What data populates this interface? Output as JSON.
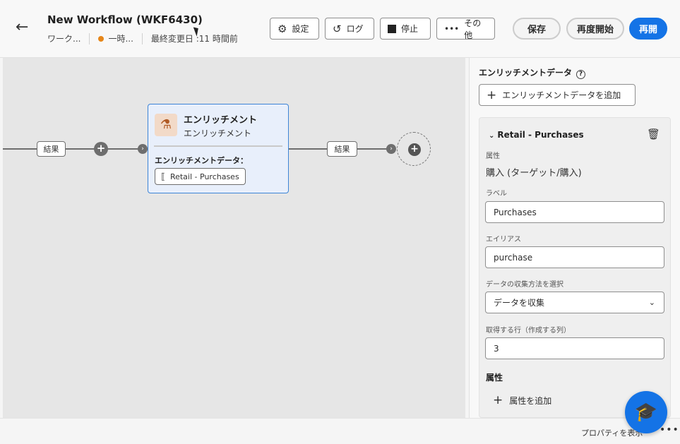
{
  "header": {
    "back_icon": "arrow-left-icon",
    "title": "New Workflow (WKF6430)",
    "meta_type": "ワーク...",
    "meta_status": "一時...",
    "meta_modified": "最終変更日 :11 時間前",
    "settings_label": "設定",
    "log_label": "ログ",
    "stop_label": "停止",
    "more_label": "その他",
    "save_label": "保存",
    "restart_label": "再度開始",
    "resume_label": "再開",
    "status_color": "#e68619",
    "accent_color": "#1473e6"
  },
  "canvas": {
    "result_chip_1": "結果",
    "result_chip_2": "結果",
    "node": {
      "title": "エンリッチメント",
      "subtitle": "エンリッチメント",
      "section_label": "エンリッチメントデータ：",
      "tag_label": "Retail - Purchases"
    }
  },
  "panel": {
    "heading": "エンリッチメントデータ",
    "add_button": "エンリッチメントデータを追加",
    "card": {
      "title": "Retail - Purchases",
      "attribute_label": "属性",
      "attribute_value": "購入 (ターゲット/購入)",
      "label_label": "ラベル",
      "label_value": "Purchases",
      "alias_label": "エイリアス",
      "alias_value": "purchase",
      "collect_label": "データの収集方法を選択",
      "collect_value": "データを収集",
      "rows_label": "取得する行（作成する列）",
      "rows_value": "3",
      "attributes_section": "属性",
      "add_attribute": "属性を追加"
    }
  },
  "footer": {
    "show_properties": "プロパティを表示"
  }
}
